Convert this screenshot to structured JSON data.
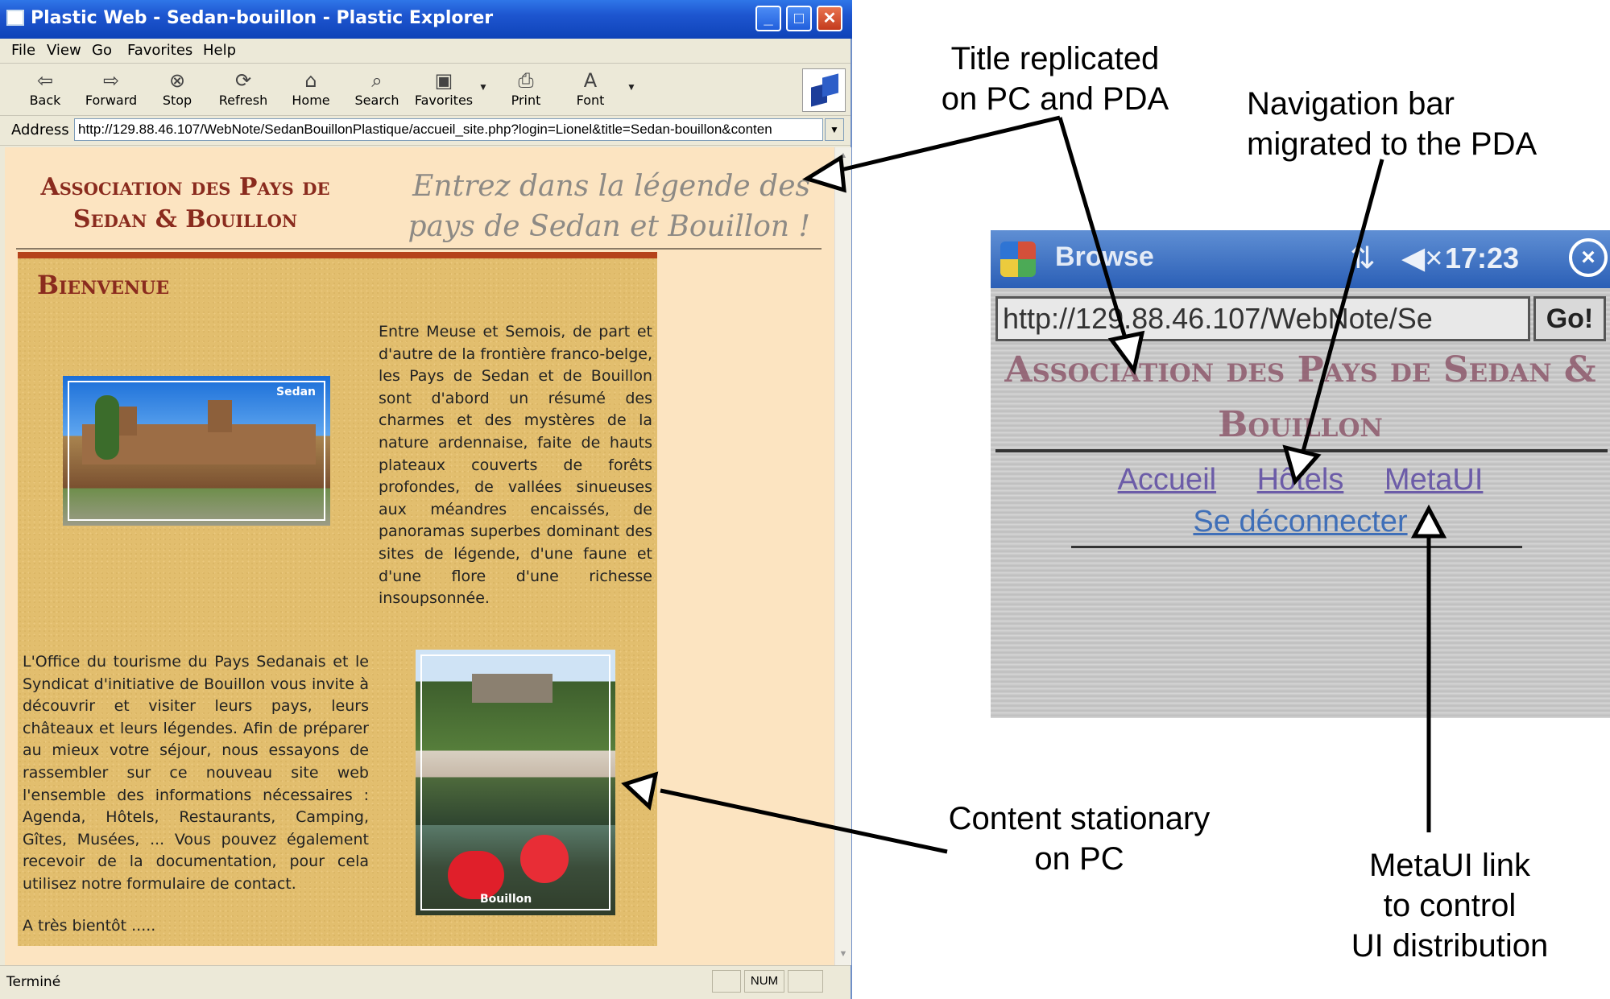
{
  "window": {
    "title": "Plastic Web - Sedan-bouillon - Plastic Explorer",
    "controls": {
      "minimize": "_",
      "maximize": "□",
      "close": "✕"
    }
  },
  "menu": [
    "File",
    "View",
    "Go",
    "Favorites",
    "Help"
  ],
  "toolbar": [
    {
      "label": "Back",
      "icon": "back-arrow-icon",
      "glyph": "⇦"
    },
    {
      "label": "Forward",
      "icon": "forward-arrow-icon",
      "glyph": "⇨"
    },
    {
      "label": "Stop",
      "icon": "stop-icon",
      "glyph": "⊗"
    },
    {
      "label": "Refresh",
      "icon": "refresh-icon",
      "glyph": "⟳"
    },
    {
      "label": "Home",
      "icon": "home-icon",
      "glyph": "⌂"
    },
    {
      "label": "Search",
      "icon": "search-icon",
      "glyph": "⌕"
    },
    {
      "label": "Favorites",
      "icon": "favorites-icon",
      "glyph": "▣"
    },
    {
      "label": "Print",
      "icon": "print-icon",
      "glyph": "⎙"
    },
    {
      "label": "Font",
      "icon": "font-icon",
      "glyph": "A"
    }
  ],
  "address": {
    "label": "Address",
    "value": "http://129.88.46.107/WebNote/SedanBouillonPlastique/accueil_site.php?login=Lionel&title=Sedan-bouillon&conten"
  },
  "page": {
    "org_title": "Association des Pays de Sedan & Bouillon",
    "tagline": "Entrez dans la légende des pays de Sedan et Bouillon !",
    "section_title": "Bienvenue",
    "intro": "Entre Meuse et Semois, de part et d'autre de la frontière franco-belge, les Pays de Sedan et de Bouillon sont d'abord un résumé des charmes et des mystères de la nature ardennaise, faite de hauts plateaux couverts de forêts profondes, de vallées sinueuses aux méandres encaissés, de panoramas superbes dominant des sites de légende, d'une faune et d'une flore d'une richesse insoupsonnée.",
    "tourism": "L'Office du tourisme du Pays Sedanais et le Syndicat d'initiative de Bouillon vous invite à découvrir et visiter leurs pays, leurs châteaux et leurs légendes. Afin de préparer au mieux votre séjour, nous essayons de rassembler sur ce nouveau site web l'ensemble des informations nécessaires : Agenda, Hôtels, Restaurants, Camping, Gîtes, Musées, ... Vous pouvez également recevoir de la documentation, pour cela utilisez notre formulaire de contact.",
    "closing": "A très bientôt .....",
    "photo_sedan_caption": "Sedan",
    "photo_bouillon_caption": "Bouillon"
  },
  "status": {
    "text": "Terminé",
    "num": "NUM"
  },
  "pda": {
    "app_name": "Browse",
    "clock": "17:23",
    "url": "http://129.88.46.107/WebNote/Se",
    "go": "Go!",
    "title": "Association des Pays de Sedan & Bouillon",
    "nav": [
      "Accueil",
      "Hôtels",
      "MetaUI"
    ],
    "logout": "Se déconnecter"
  },
  "annotations": {
    "title": "Title replicated\non PC and PDA",
    "nav": "Navigation bar\nmigrated to the PDA",
    "content": "Content stationary\non PC",
    "meta": "MetaUI link\nto control\nUI distribution"
  },
  "colors": {
    "xp_blue": "#1d55cf",
    "page_background": "#fce4c1",
    "panel_texture": "#e2be6e",
    "title_red": "#8a2b1e",
    "pda_link": "#6c5ca8"
  }
}
